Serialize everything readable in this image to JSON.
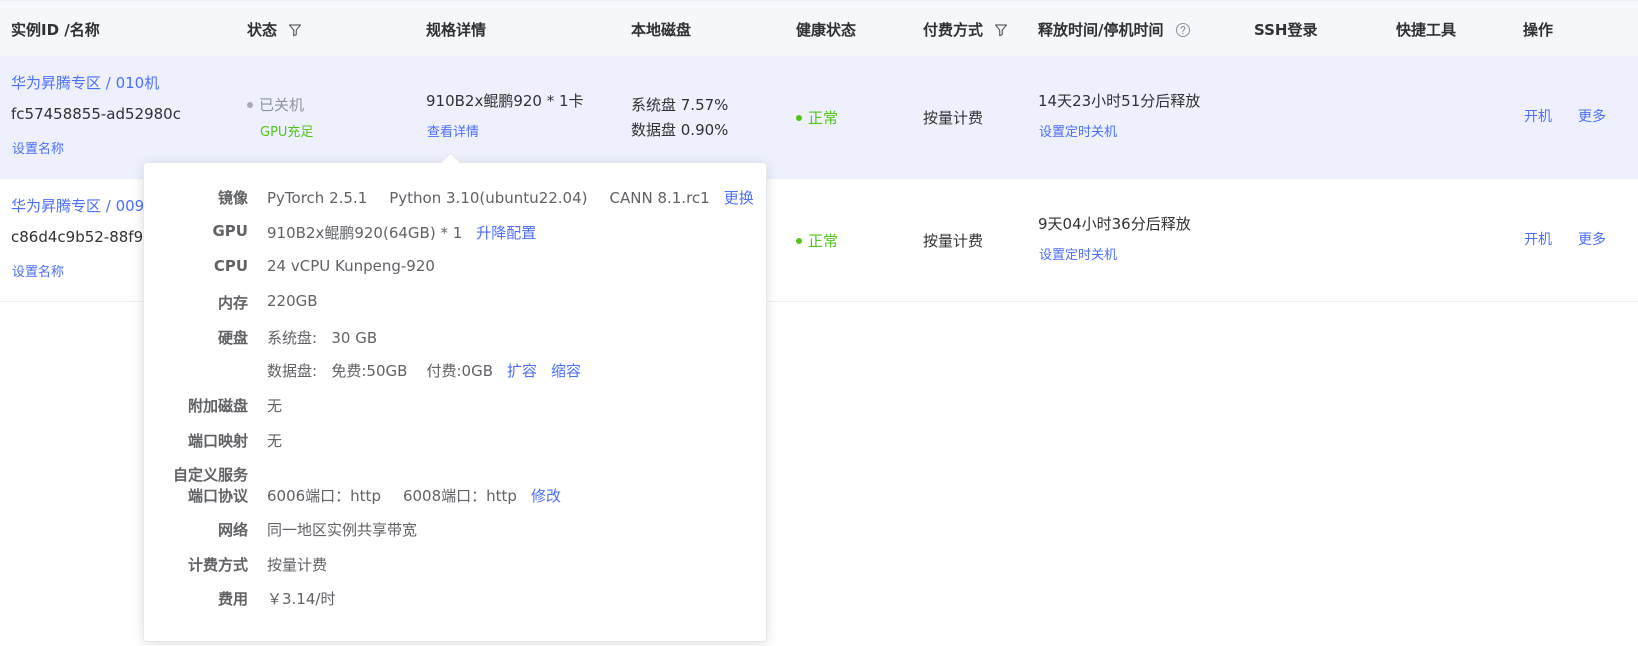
{
  "header": {
    "col_instance": "实例ID /名称",
    "col_status": "状态",
    "col_spec": "规格详情",
    "col_disk": "本地磁盘",
    "col_health": "健康状态",
    "col_billing": "付费方式",
    "col_release": "释放时间/停机时间",
    "col_ssh": "SSH登录",
    "col_tools": "快捷工具",
    "col_actions": "操作"
  },
  "rows": [
    {
      "zone_name": "华为昇腾专区 / 010机",
      "id": "fc57458855-ad52980c",
      "set_name": "设置名称",
      "status": "已关机",
      "gpu_status": "GPU充足",
      "spec": "910B2x鲲鹏920 * 1卡",
      "spec_link": "查看详情",
      "sys_disk": "系统盘 7.57%",
      "data_disk": "数据盘 0.90%",
      "health": "正常",
      "billing": "按量计费",
      "release": "14天23小时51分后释放",
      "timer_link": "设置定时关机",
      "action_start": "开机",
      "action_more": "更多"
    },
    {
      "zone_name": "华为昇腾专区 / 009",
      "id": "c86d4c9b52-88f91",
      "set_name": "设置名称",
      "health": "正常",
      "billing": "按量计费",
      "release": "9天04小时36分后释放",
      "timer_link": "设置定时关机",
      "action_start": "开机",
      "action_more": "更多"
    }
  ],
  "popover": {
    "image_label": "镜像",
    "image_pytorch": "PyTorch  2.5.1",
    "image_python": "Python  3.10(ubuntu22.04)",
    "image_cann": "CANN  8.1.rc1",
    "image_change": "更换",
    "gpu_label": "GPU",
    "gpu_value": "910B2x鲲鹏920(64GB) * 1",
    "gpu_upgrade": "升降配置",
    "cpu_label": "CPU",
    "cpu_value": "24 vCPU Kunpeng-920",
    "mem_label": "内存",
    "mem_value": "220GB",
    "disk_label": "硬盘",
    "sys_disk": "系统盘:   30 GB",
    "data_disk": "数据盘:   免费:50GB    付费:0GB",
    "expand": "扩容",
    "shrink": "缩容",
    "extra_disk_label": "附加磁盘",
    "extra_disk_value": "无",
    "port_map_label": "端口映射",
    "port_map_value": "无",
    "custom_service_label1": "自定义服务",
    "custom_service_label2": "端口协议",
    "port_6006": "6006端口：http",
    "port_6008": "6008端口：http",
    "port_modify": "修改",
    "network_label": "网络",
    "network_value": "同一地区实例共享带宽",
    "billing_label": "计费方式",
    "billing_value": "按量计费",
    "fee_label": "费用",
    "fee_value": "￥3.14/时"
  },
  "colors": {
    "link": "#4c6fff",
    "green": "#52c41a",
    "row_highlight": "#eef1fd",
    "header_bg": "#f5f7fa"
  }
}
